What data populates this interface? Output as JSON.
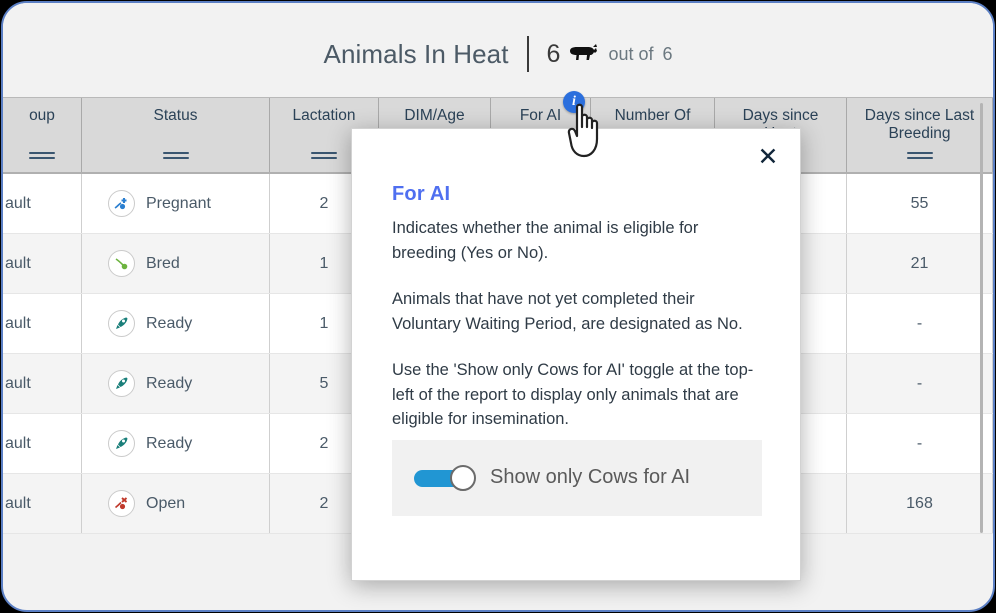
{
  "header": {
    "title": "Animals In Heat",
    "count": "6",
    "cow_icon": "cow-icon",
    "out_of_label": "out of",
    "total": "6"
  },
  "table": {
    "columns": [
      {
        "label": "oup",
        "name": "group",
        "sortable": true
      },
      {
        "label": "Status",
        "name": "status",
        "sortable": true
      },
      {
        "label": "Lactation",
        "name": "lactation",
        "sortable": true
      },
      {
        "label": "DIM/Age",
        "name": "dim-age",
        "sortable": false
      },
      {
        "label": "For AI",
        "name": "for-ai",
        "sortable": false
      },
      {
        "label": "Number Of",
        "name": "number-of",
        "sortable": false
      },
      {
        "label": "Days since\nHeat",
        "name": "days-since-heat",
        "sortable": false
      },
      {
        "label": "Days since Last\nBreeding",
        "name": "days-since-last-breeding",
        "sortable": true
      }
    ],
    "rows": [
      {
        "group": "ault",
        "status": "Pregnant",
        "status_icon": "pregnant-icon",
        "lactation": "2",
        "dim": "",
        "for_ai": "",
        "number_of": "",
        "days_since_heat": "",
        "days_since_last_breeding": "55"
      },
      {
        "group": "ault",
        "status": "Bred",
        "status_icon": "bred-icon",
        "lactation": "1",
        "dim": "",
        "for_ai": "",
        "number_of": "",
        "days_since_heat": "",
        "days_since_last_breeding": "21"
      },
      {
        "group": "ault",
        "status": "Ready",
        "status_icon": "ready-icon",
        "lactation": "1",
        "dim": "",
        "for_ai": "",
        "number_of": "",
        "days_since_heat": "",
        "days_since_last_breeding": "-"
      },
      {
        "group": "ault",
        "status": "Ready",
        "status_icon": "ready-icon",
        "lactation": "5",
        "dim": "",
        "for_ai": "",
        "number_of": "",
        "days_since_heat": "",
        "days_since_last_breeding": "-"
      },
      {
        "group": "ault",
        "status": "Ready",
        "status_icon": "ready-icon",
        "lactation": "2",
        "dim": "",
        "for_ai": "",
        "number_of": "",
        "days_since_heat": "",
        "days_since_last_breeding": "-"
      },
      {
        "group": "ault",
        "status": "Open",
        "status_icon": "open-icon",
        "lactation": "2",
        "dim": "",
        "for_ai": "",
        "number_of": "",
        "days_since_heat": "",
        "days_since_last_breeding": "168"
      }
    ]
  },
  "info_badge": {
    "glyph": "i"
  },
  "modal": {
    "close_glyph": "✕",
    "title": "For AI",
    "paragraph1": "Indicates whether the animal is eligible for breeding (Yes or No).",
    "paragraph2": "Animals that have not yet completed their Voluntary Waiting Period, are designated as No.",
    "paragraph3": "Use the 'Show only Cows for AI' toggle at the top-left of the report to display only animals that are eligible for insemination.",
    "toggle": {
      "label": "Show only Cows for AI",
      "state": "on"
    }
  },
  "colors": {
    "accent_blue": "#4f6ff0",
    "toggle_blue": "#2196d3",
    "info_badge_blue": "#2b6fdd",
    "frame_border": "#5b7fc4",
    "header_bg": "#d9d9d9",
    "page_bg": "#f2f2f2",
    "text_dark": "#2b4257"
  }
}
